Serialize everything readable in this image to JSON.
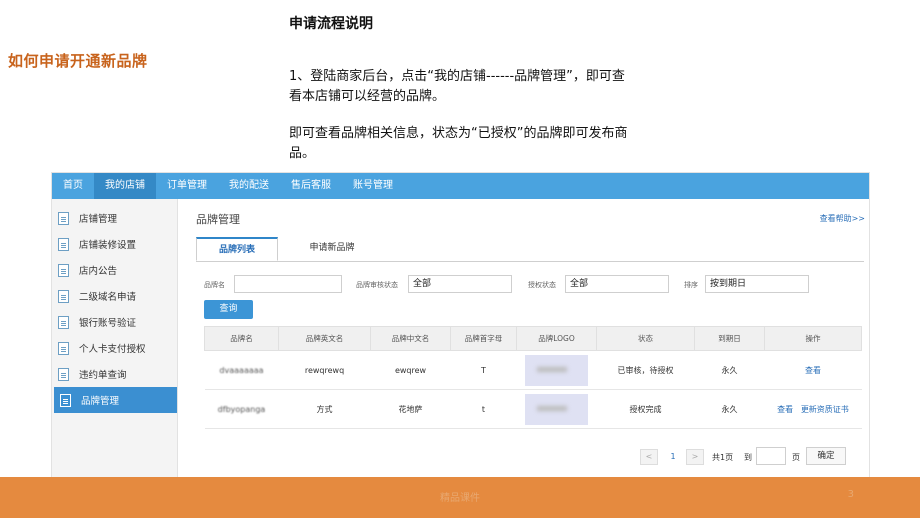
{
  "slide": {
    "side_title": "如何申请开通新品牌",
    "section_title": "申请流程说明",
    "paragraph1": "1、登陆商家后台，点击“我的店铺------品牌管理”，即可查看本店铺可以经营的品牌。",
    "paragraph2": "即可查看品牌相关信息，状态为“已授权”的品牌即可发布商品。",
    "footer_text": "精品课件",
    "page_number": "3"
  },
  "topnav": [
    "首页",
    "我的店铺",
    "订单管理",
    "我的配送",
    "售后客服",
    "账号管理"
  ],
  "topnav_active": "我的店铺",
  "sidebar": [
    "店铺管理",
    "店铺装修设置",
    "店内公告",
    "二级域名申请",
    "银行账号验证",
    "个人卡支付授权",
    "违约单查询",
    "品牌管理"
  ],
  "sidebar_active": "品牌管理",
  "main": {
    "title": "品牌管理",
    "help_link": "查看帮助>>",
    "tabs": [
      "品牌列表",
      "申请新品牌"
    ],
    "filters": {
      "brand_name_label": "品牌名",
      "review_status_label": "品牌审核状态",
      "review_status_value": "全部",
      "auth_status_label": "授权状态",
      "auth_status_value": "全部",
      "sort_label": "排序",
      "sort_value": "按到期日"
    },
    "query_button": "查询",
    "table": {
      "headers": [
        "品牌名",
        "品牌英文名",
        "品牌中文名",
        "品牌首字母",
        "品牌LOGO",
        "状态",
        "到期日",
        "操作"
      ],
      "rows": [
        {
          "name": "dvaaaaaaa",
          "en": "rewqrewq",
          "cn": "ewqrew",
          "initial": "T",
          "status": "已审核，待授权",
          "expire": "永久",
          "actions": [
            "查看"
          ]
        },
        {
          "name": "dfbyopanga",
          "en": "方式",
          "cn": "花地萨",
          "initial": "t",
          "status": "授权完成",
          "expire": "永久",
          "actions": [
            "查看",
            "更新资质证书"
          ]
        }
      ]
    },
    "pager": {
      "prev": "<",
      "current": "1",
      "next": ">",
      "total": "共1页",
      "to": "到",
      "page": "页",
      "confirm": "确定"
    }
  },
  "colors": {
    "nav": "#4aa3df",
    "accent_title": "#c8631c",
    "footer": "#e58a3f"
  }
}
